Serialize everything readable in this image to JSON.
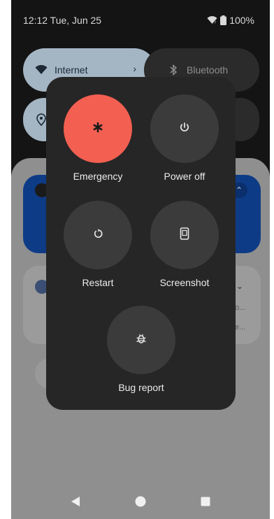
{
  "status_bar": {
    "time_date": "12:12 Tue, Jun 25",
    "battery": "100%",
    "icons": [
      "wifi-icon",
      "battery-icon"
    ]
  },
  "quick_settings": {
    "tiles": [
      {
        "label": "Internet",
        "icon": "wifi-icon",
        "active": true
      },
      {
        "label": "Bluetooth",
        "icon": "bluetooth-icon",
        "active": false
      },
      {
        "label": "",
        "icon": "location-icon",
        "active": true
      }
    ]
  },
  "notifications": {
    "gray_text_1": "o...",
    "gray_text_2": "e..."
  },
  "power_menu": {
    "items": [
      {
        "label": "Emergency",
        "icon": "asterisk-icon"
      },
      {
        "label": "Power off",
        "icon": "power-icon"
      },
      {
        "label": "Restart",
        "icon": "restart-icon"
      },
      {
        "label": "Screenshot",
        "icon": "screenshot-icon"
      },
      {
        "label": "Bug report",
        "icon": "bug-icon"
      }
    ]
  },
  "nav_bar": {
    "buttons": [
      "back-icon",
      "home-icon",
      "recents-icon"
    ]
  },
  "colors": {
    "emergency_accent": "#f35f51",
    "menu_background": "#262626",
    "button_background": "#3b3b3b",
    "active_tile": "#a4b5c4"
  }
}
